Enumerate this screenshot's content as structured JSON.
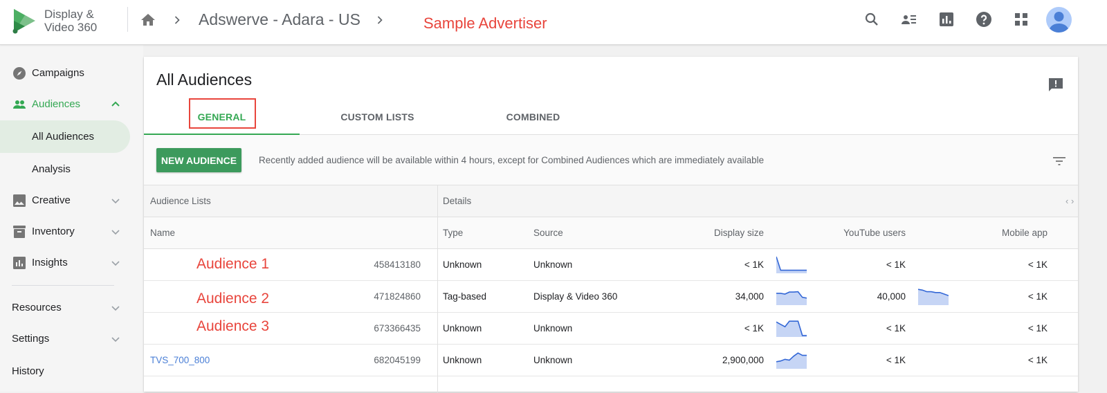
{
  "header": {
    "logo_line1": "Display &",
    "logo_line2": "Video 360",
    "breadcrumb_title": "Adswerve - Adara - US",
    "advertiser_label": "Sample Advertiser",
    "icons": [
      "search-icon",
      "contacts-icon",
      "reports-icon",
      "help-icon",
      "apps-icon",
      "account-avatar"
    ]
  },
  "sidebar": {
    "items": [
      {
        "label": "Campaigns",
        "icon": "compass-icon"
      },
      {
        "label": "Audiences",
        "icon": "people-icon",
        "expanded": true
      },
      {
        "label": "All Audiences",
        "selected": true
      },
      {
        "label": "Analysis"
      },
      {
        "label": "Creative",
        "icon": "image-icon"
      },
      {
        "label": "Inventory",
        "icon": "archive-icon"
      },
      {
        "label": "Insights",
        "icon": "chart-icon"
      },
      {
        "label": "Resources"
      },
      {
        "label": "Settings"
      },
      {
        "label": "History"
      }
    ]
  },
  "main": {
    "title": "All Audiences",
    "tabs": [
      {
        "label": "GENERAL",
        "active": true
      },
      {
        "label": "CUSTOM LISTS"
      },
      {
        "label": "COMBINED"
      }
    ],
    "new_button": "NEW AUDIENCE",
    "notice": "Recently added audience will be available within 4 hours, except for Combined Audiences which are immediately available",
    "table": {
      "group_headers": [
        "Audience Lists",
        "Details"
      ],
      "columns": [
        "Name",
        "Type",
        "Source",
        "Display size",
        "YouTube users",
        "Mobile app"
      ],
      "rows": [
        {
          "name": "Audience 1",
          "id": "458413180",
          "type": "Unknown",
          "source": "Unknown",
          "display_size": "< 1K",
          "youtube_users": "< 1K",
          "mobile_app": "< 1K",
          "display_trend": [
            1.0,
            0.15,
            0.15,
            0.15,
            0.15,
            0.15,
            0.15,
            0.15
          ],
          "youtube_trend": null
        },
        {
          "name": "Audience 2",
          "id": "471824860",
          "type": "Tag-based",
          "source": "Display & Video 360",
          "display_size": "34,000",
          "youtube_users": "40,000",
          "mobile_app": "< 1K",
          "display_trend": [
            0.7,
            0.7,
            0.65,
            0.78,
            0.78,
            0.8,
            0.45,
            0.4
          ],
          "youtube_trend": [
            0.95,
            0.9,
            0.8,
            0.8,
            0.75,
            0.75,
            0.65,
            0.55
          ]
        },
        {
          "name": "Audience 3",
          "id": "673366435",
          "type": "Unknown",
          "source": "Unknown",
          "display_size": "< 1K",
          "youtube_users": "< 1K",
          "mobile_app": "< 1K",
          "display_trend": [
            0.9,
            0.75,
            0.6,
            0.95,
            0.95,
            0.95,
            0.05,
            0.05
          ],
          "youtube_trend": null
        },
        {
          "name": "TVS_700_800",
          "id": "682045199",
          "type": "Unknown",
          "source": "Unknown",
          "display_size": "2,900,000",
          "youtube_users": "< 1K",
          "mobile_app": "< 1K",
          "display_trend": [
            0.4,
            0.45,
            0.55,
            0.5,
            0.75,
            0.95,
            0.8,
            0.8
          ],
          "youtube_trend": null
        }
      ]
    }
  },
  "colors": {
    "accent_green": "#34a853",
    "button_green": "#3c9a5c",
    "annotation_red": "#e8453c",
    "link_blue": "#4a7fd6",
    "spark_line": "#3367d6",
    "spark_fill": "#c6d5f5"
  }
}
